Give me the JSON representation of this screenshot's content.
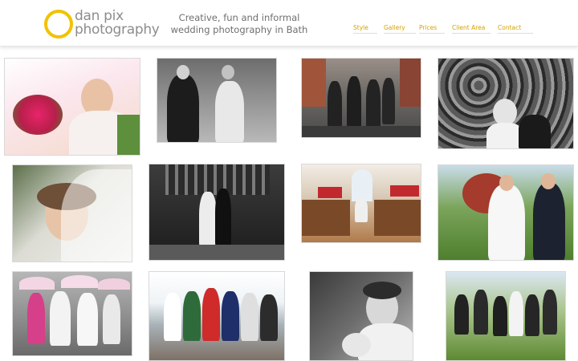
{
  "brand": {
    "logo_line1": "dan pix",
    "logo_line2": "photography",
    "tagline_line1": "Creative, fun and informal",
    "tagline_line2": "wedding photography in Bath",
    "accent_color": "#f2c200",
    "text_color": "#8d8d8d",
    "nav_color": "#d3a300"
  },
  "nav": {
    "items": [
      {
        "label": "Style"
      },
      {
        "label": "Gallery"
      },
      {
        "label": "Prices"
      },
      {
        "label": "Client Area"
      },
      {
        "label": "Contact"
      }
    ]
  },
  "gallery": {
    "photos": [
      {
        "name": "bride-bouquet-photo",
        "style": "color"
      },
      {
        "name": "couple-walking-bw-photo",
        "style": "bw"
      },
      {
        "name": "groomsmen-street-photo",
        "style": "color"
      },
      {
        "name": "crowd-bw-photo",
        "style": "bw"
      },
      {
        "name": "bride-veil-photo",
        "style": "color"
      },
      {
        "name": "couple-bridge-bw-photo",
        "style": "bw"
      },
      {
        "name": "church-aisle-photo",
        "style": "color"
      },
      {
        "name": "couple-garden-photo",
        "style": "color"
      },
      {
        "name": "bridesmaids-umbrellas-photo",
        "style": "color"
      },
      {
        "name": "beach-group-photo",
        "style": "color"
      },
      {
        "name": "bride-tiara-bw-photo",
        "style": "bw"
      },
      {
        "name": "party-jumping-photo",
        "style": "color"
      }
    ]
  }
}
